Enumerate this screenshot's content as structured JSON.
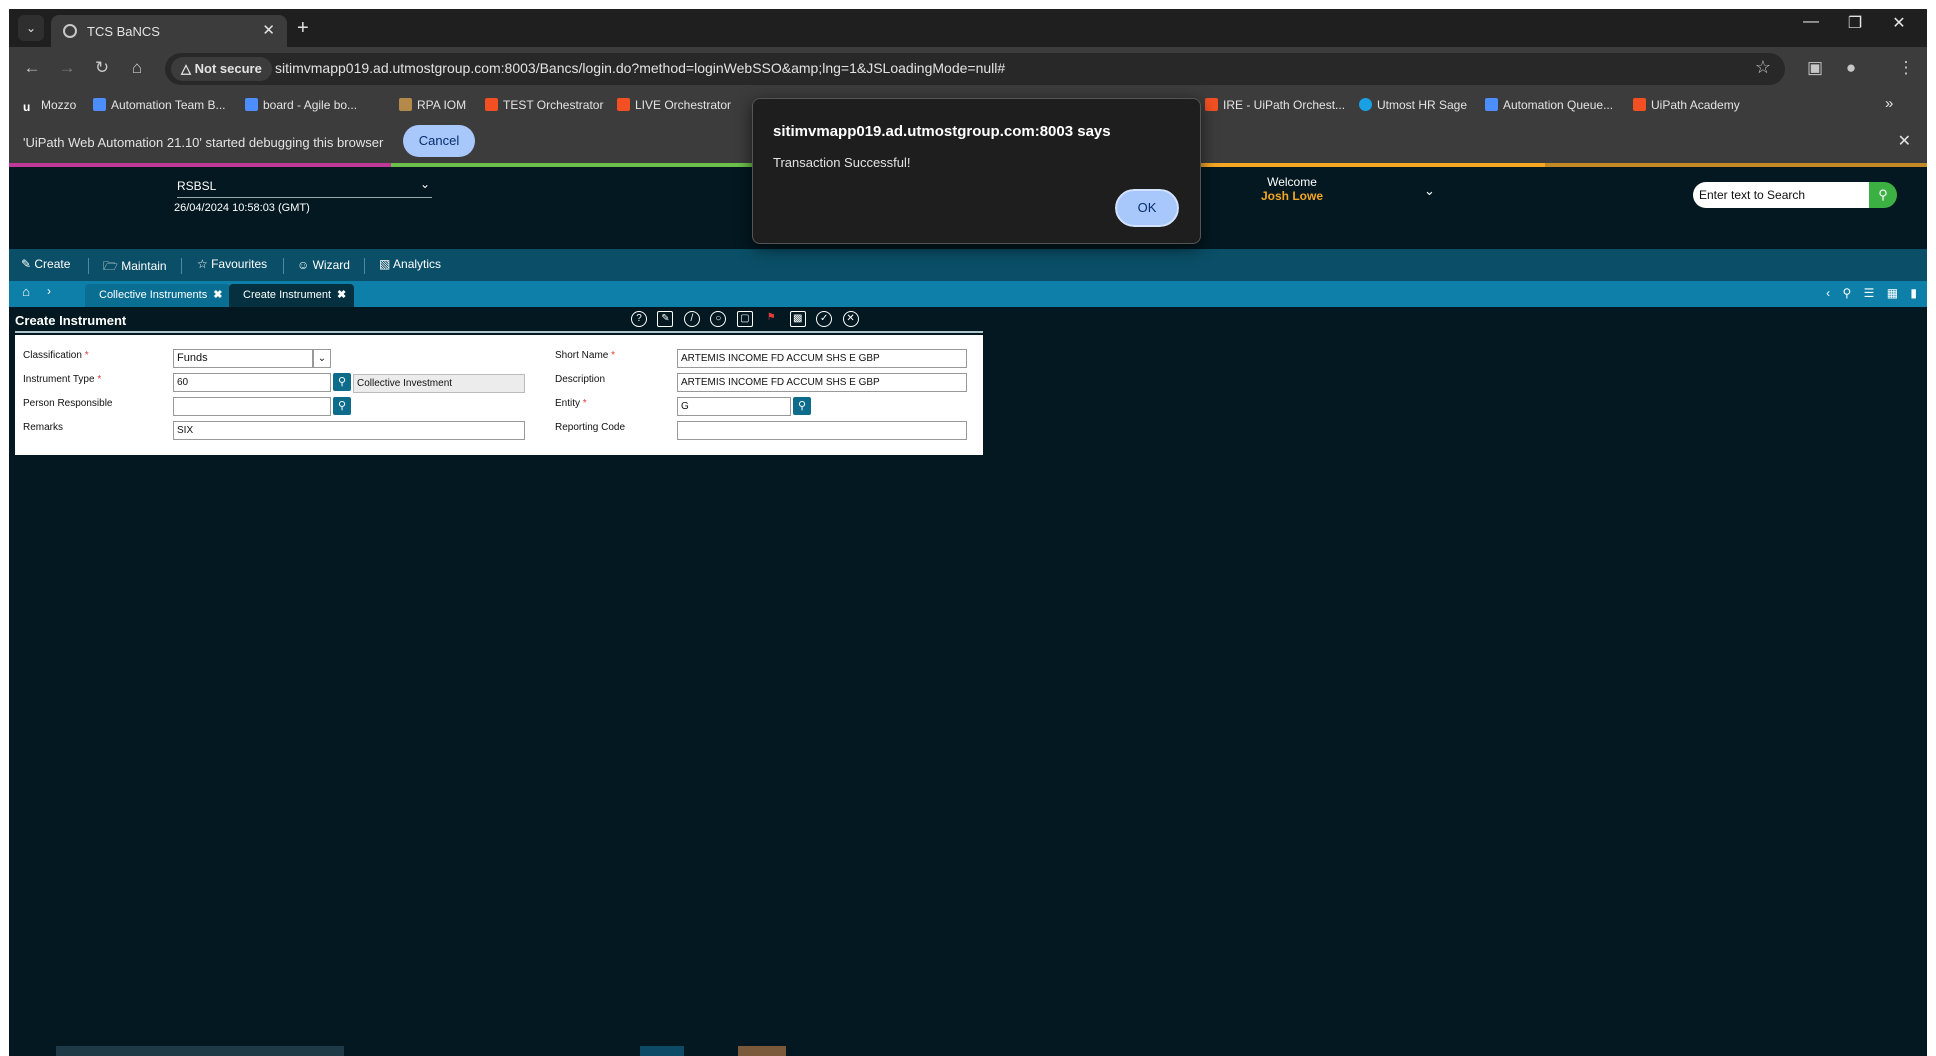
{
  "browser": {
    "tab_title": "TCS BaNCS",
    "tab_close": "✕",
    "new_tab": "+",
    "tab_list": "⌄",
    "window_controls": [
      "—",
      "❐",
      "✕"
    ],
    "security_label": "Not secure",
    "url": "sitimvmapp019.ad.utmostgroup.com:8003/Bancs/login.do?method=loginWebSSO&amp;lng=1&JSLoadingMode=null#",
    "icons": [
      "arrow-left-icon",
      "arrow-right-icon",
      "reload-icon",
      "home-icon",
      "warning-icon",
      "star-icon",
      "extensions-icon",
      "profile-icon",
      "menu-icon"
    ]
  },
  "bookmarks": [
    {
      "label": "Mozzo",
      "color": "#ffffff"
    },
    {
      "label": "Automation Team B...",
      "color": "#4c8dff"
    },
    {
      "label": "board - Agile bo...",
      "color": "#4c8dff"
    },
    {
      "label": "RPA IOM",
      "color": "#b5894a"
    },
    {
      "label": "TEST Orchestrator",
      "color": "#f25022"
    },
    {
      "label": "LIVE Orchestrator",
      "color": "#f25022"
    },
    {
      "label": "IRE - UiPath Orchest...",
      "color": "#f25022"
    },
    {
      "label": "Utmost HR Sage",
      "color": "#1aa1e3"
    },
    {
      "label": "Automation Queue...",
      "color": "#4c8dff"
    },
    {
      "label": "UiPath Academy",
      "color": "#f25022"
    }
  ],
  "bookmarks_more": "»",
  "infobar": {
    "text": "'UiPath Web Automation 21.10' started debugging this browser",
    "cancel": "Cancel",
    "close": "✕"
  },
  "app": {
    "bank": "RSBSL",
    "datetime": "26/04/2024 10:58:03 (GMT)",
    "welcome": "Welcome",
    "user": "Josh Lowe",
    "search_placeholder": "Enter text to Search",
    "menu": [
      "Create",
      "Maintain",
      "Favourites",
      "Wizard",
      "Analytics"
    ],
    "tabs": [
      "Collective Instruments",
      "Create Instrument"
    ],
    "accent_colors": [
      "#c0399a",
      "#6cc04a",
      "#1c9fd6",
      "#f5a623"
    ]
  },
  "form": {
    "title": "Create Instrument",
    "fields": {
      "classification_label": "Classification",
      "classification_value": "Funds",
      "instrument_type_label": "Instrument Type",
      "instrument_type_value": "60",
      "instrument_type_desc": "Collective Investment",
      "person_responsible_label": "Person Responsible",
      "person_responsible_value": "",
      "remarks_label": "Remarks",
      "remarks_value": "SIX",
      "short_name_label": "Short Name",
      "short_name_value": "ARTEMIS INCOME FD ACCUM SHS E GBP",
      "description_label": "Description",
      "description_value": "ARTEMIS INCOME FD ACCUM SHS E GBP",
      "entity_label": "Entity",
      "entity_value": "G",
      "reporting_code_label": "Reporting Code",
      "reporting_code_value": ""
    },
    "required_mark": "*"
  },
  "dialog": {
    "title": "sitimvmapp019.ad.utmostgroup.com:8003 says",
    "message": "Transaction Successful!",
    "ok": "OK"
  }
}
